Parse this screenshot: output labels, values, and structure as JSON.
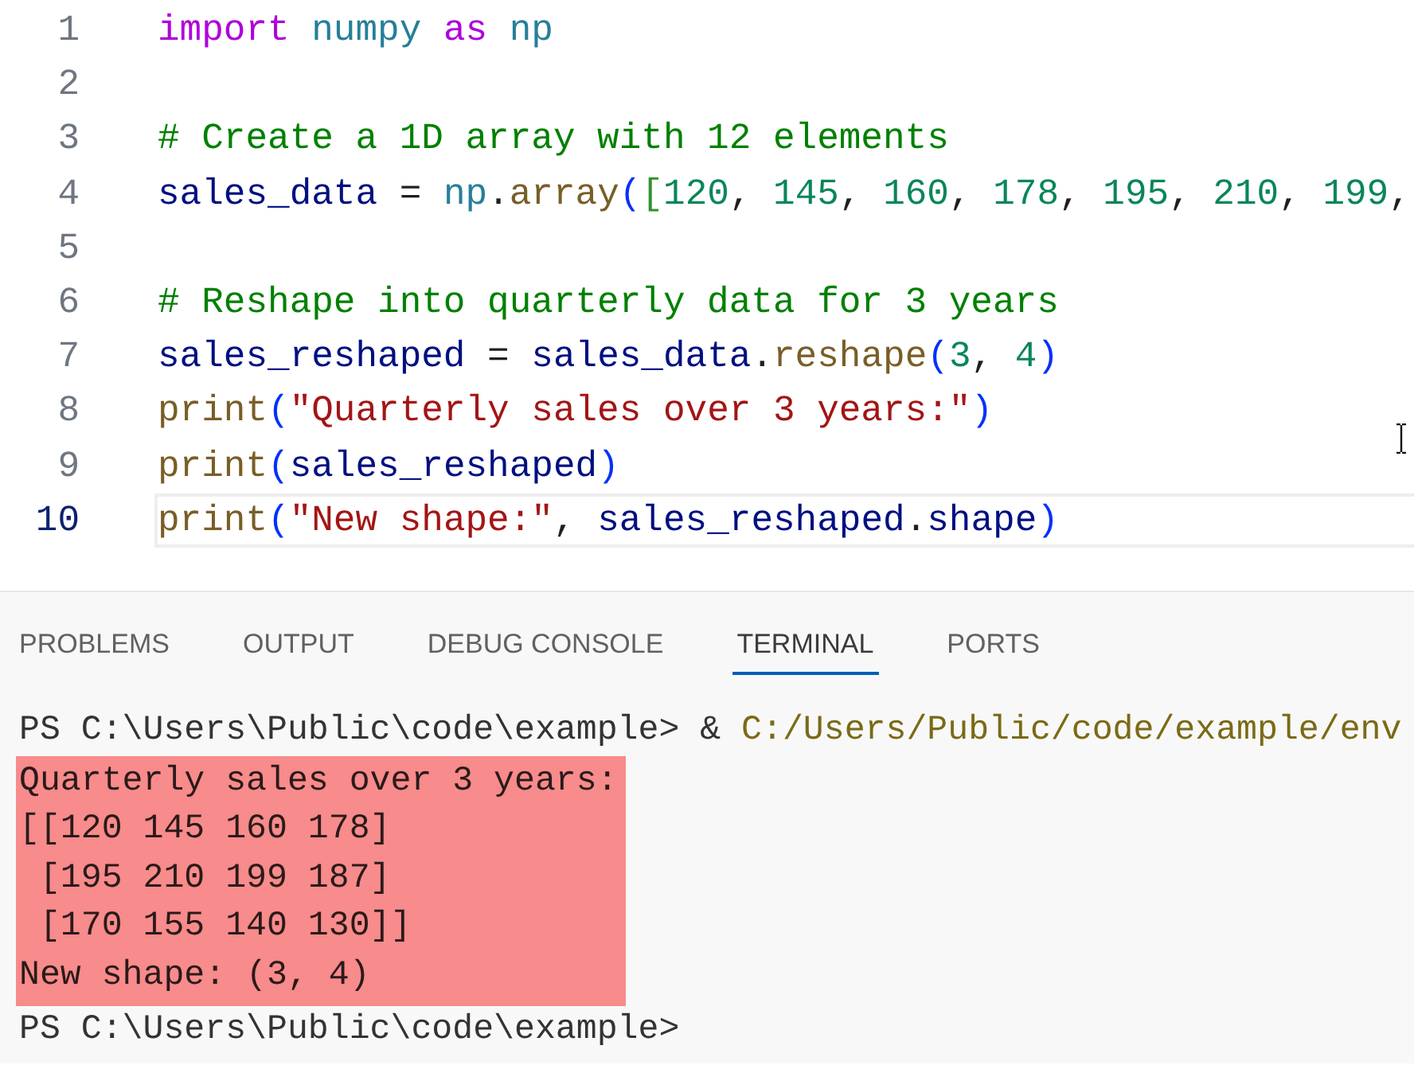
{
  "editor": {
    "lines": [
      {
        "number": "1",
        "current": false,
        "tokens": [
          {
            "text": "import ",
            "kind": "keyword"
          },
          {
            "text": "numpy ",
            "kind": "module"
          },
          {
            "text": "as ",
            "kind": "keyword"
          },
          {
            "text": "np",
            "kind": "module"
          }
        ]
      },
      {
        "number": "2",
        "current": false
      },
      {
        "number": "3",
        "current": false,
        "tokens": [
          {
            "text": "# Create a 1D array with 12 elements",
            "kind": "comment"
          }
        ]
      },
      {
        "number": "4",
        "current": false,
        "tokens": [
          {
            "text": "sales_data",
            "kind": "variable"
          },
          {
            "text": " = ",
            "kind": "plain"
          },
          {
            "text": "np",
            "kind": "module"
          },
          {
            "text": ".",
            "kind": "plain"
          },
          {
            "text": "array",
            "kind": "function"
          },
          {
            "text": "(",
            "kind": "bracket1"
          },
          {
            "text": "[",
            "kind": "bracket2"
          },
          {
            "text": "120",
            "kind": "number"
          },
          {
            "text": ", ",
            "kind": "plain"
          },
          {
            "text": "145",
            "kind": "number"
          },
          {
            "text": ", ",
            "kind": "plain"
          },
          {
            "text": "160",
            "kind": "number"
          },
          {
            "text": ", ",
            "kind": "plain"
          },
          {
            "text": "178",
            "kind": "number"
          },
          {
            "text": ", ",
            "kind": "plain"
          },
          {
            "text": "195",
            "kind": "number"
          },
          {
            "text": ", ",
            "kind": "plain"
          },
          {
            "text": "210",
            "kind": "number"
          },
          {
            "text": ", ",
            "kind": "plain"
          },
          {
            "text": "199",
            "kind": "number"
          },
          {
            "text": ",",
            "kind": "plain"
          }
        ]
      },
      {
        "number": "5",
        "current": false
      },
      {
        "number": "6",
        "current": false,
        "tokens": [
          {
            "text": "# Reshape into quarterly data for 3 years",
            "kind": "comment"
          }
        ]
      },
      {
        "number": "7",
        "current": false,
        "tokens": [
          {
            "text": "sales_reshaped",
            "kind": "variable"
          },
          {
            "text": " = ",
            "kind": "plain"
          },
          {
            "text": "sales_data",
            "kind": "variable"
          },
          {
            "text": ".",
            "kind": "plain"
          },
          {
            "text": "reshape",
            "kind": "function"
          },
          {
            "text": "(",
            "kind": "bracket1"
          },
          {
            "text": "3",
            "kind": "number"
          },
          {
            "text": ", ",
            "kind": "plain"
          },
          {
            "text": "4",
            "kind": "number"
          },
          {
            "text": ")",
            "kind": "bracket1"
          }
        ]
      },
      {
        "number": "8",
        "current": false,
        "tokens": [
          {
            "text": "print",
            "kind": "function"
          },
          {
            "text": "(",
            "kind": "bracket1"
          },
          {
            "text": "\"Quarterly sales over 3 years:\"",
            "kind": "string"
          },
          {
            "text": ")",
            "kind": "bracket1"
          }
        ]
      },
      {
        "number": "9",
        "current": false,
        "tokens": [
          {
            "text": "print",
            "kind": "function"
          },
          {
            "text": "(",
            "kind": "bracket1"
          },
          {
            "text": "sales_reshaped",
            "kind": "variable"
          },
          {
            "text": ")",
            "kind": "bracket1"
          }
        ]
      },
      {
        "number": "10",
        "current": true,
        "tokens": [
          {
            "text": "print",
            "kind": "function"
          },
          {
            "text": "(",
            "kind": "bracket1"
          },
          {
            "text": "\"New shape:\"",
            "kind": "string"
          },
          {
            "text": ", ",
            "kind": "plain"
          },
          {
            "text": "sales_reshaped",
            "kind": "variable"
          },
          {
            "text": ".",
            "kind": "plain"
          },
          {
            "text": "shape",
            "kind": "variable"
          },
          {
            "text": ")",
            "kind": "bracket1"
          }
        ]
      }
    ]
  },
  "panel": {
    "tabs": [
      {
        "label": "PROBLEMS",
        "selected": false
      },
      {
        "label": "OUTPUT",
        "selected": false
      },
      {
        "label": "DEBUG CONSOLE",
        "selected": false
      },
      {
        "label": "TERMINAL",
        "selected": true
      },
      {
        "label": "PORTS",
        "selected": false
      }
    ]
  },
  "terminal": {
    "blocks": [
      {
        "highlighted": false,
        "lines": [
          {
            "segments": [
              {
                "text": "PS C:\\Users\\Public\\code\\example> & ",
                "kind": "prompt"
              },
              {
                "text": "C:/Users/Public/code/example/env",
                "kind": "path"
              }
            ]
          }
        ]
      },
      {
        "highlighted": true,
        "lines": [
          {
            "segments": [
              {
                "text": "Quarterly sales over 3 years:",
                "kind": "output"
              }
            ]
          },
          {
            "segments": [
              {
                "text": "[[120 145 160 178]",
                "kind": "output"
              }
            ]
          },
          {
            "segments": [
              {
                "text": " [195 210 199 187]",
                "kind": "output"
              }
            ]
          },
          {
            "segments": [
              {
                "text": " [170 155 140 130]]",
                "kind": "output"
              }
            ]
          },
          {
            "segments": [
              {
                "text": "New shape: (3, 4)",
                "kind": "output"
              }
            ]
          }
        ]
      },
      {
        "highlighted": false,
        "lines": [
          {
            "segments": [
              {
                "text": "PS C:\\Users\\Public\\code\\example>",
                "kind": "prompt"
              }
            ]
          }
        ]
      }
    ]
  }
}
